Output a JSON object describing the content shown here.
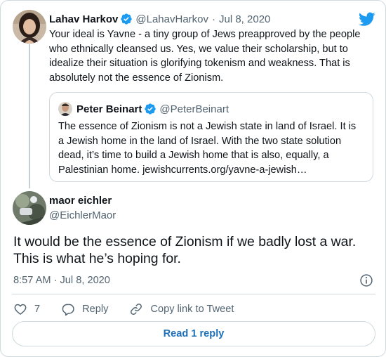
{
  "parent_tweet": {
    "author_name": "Lahav Harkov",
    "handle": "@LahavHarkov",
    "separator": "·",
    "date": "Jul 8, 2020",
    "text": "Your ideal is Yavne - a tiny group of Jews preapproved by the people who ethnically cleansed us. Yes, we value their scholarship, but to idealize their situation is glorifying tokenism and weakness. That is absolutely not the essence of Zionism."
  },
  "quoted_tweet": {
    "author_name": "Peter Beinart",
    "handle": "@PeterBeinart",
    "text": "The essence of Zionism is not a Jewish state in land of Israel. It is a Jewish home in the land of Israel. With the two state solution dead, it’s time to build a Jewish home that is also, equally, a Palestinian home. jewishcurrents.org/yavne-a-jewish…"
  },
  "main_tweet": {
    "author_name": "maor eichler",
    "handle": "@EichlerMaor",
    "text": "It would be the essence of Zionism if we badly lost a war. This is what he’s hoping for.",
    "timestamp": "8:57 AM · Jul 8, 2020"
  },
  "actions": {
    "like_count": "7",
    "reply_label": "Reply",
    "copy_link_label": "Copy link to Tweet"
  },
  "read_reply_label": "Read 1 reply",
  "colors": {
    "verified": "#1d9bf0",
    "twitter_logo": "#1d9bf0",
    "link": "#1d6fb8",
    "secondary_text": "#536471",
    "border": "#cfd9de"
  },
  "icons": [
    "verified-badge-icon",
    "twitter-logo-icon",
    "info-icon",
    "heart-icon",
    "reply-icon",
    "link-icon"
  ]
}
